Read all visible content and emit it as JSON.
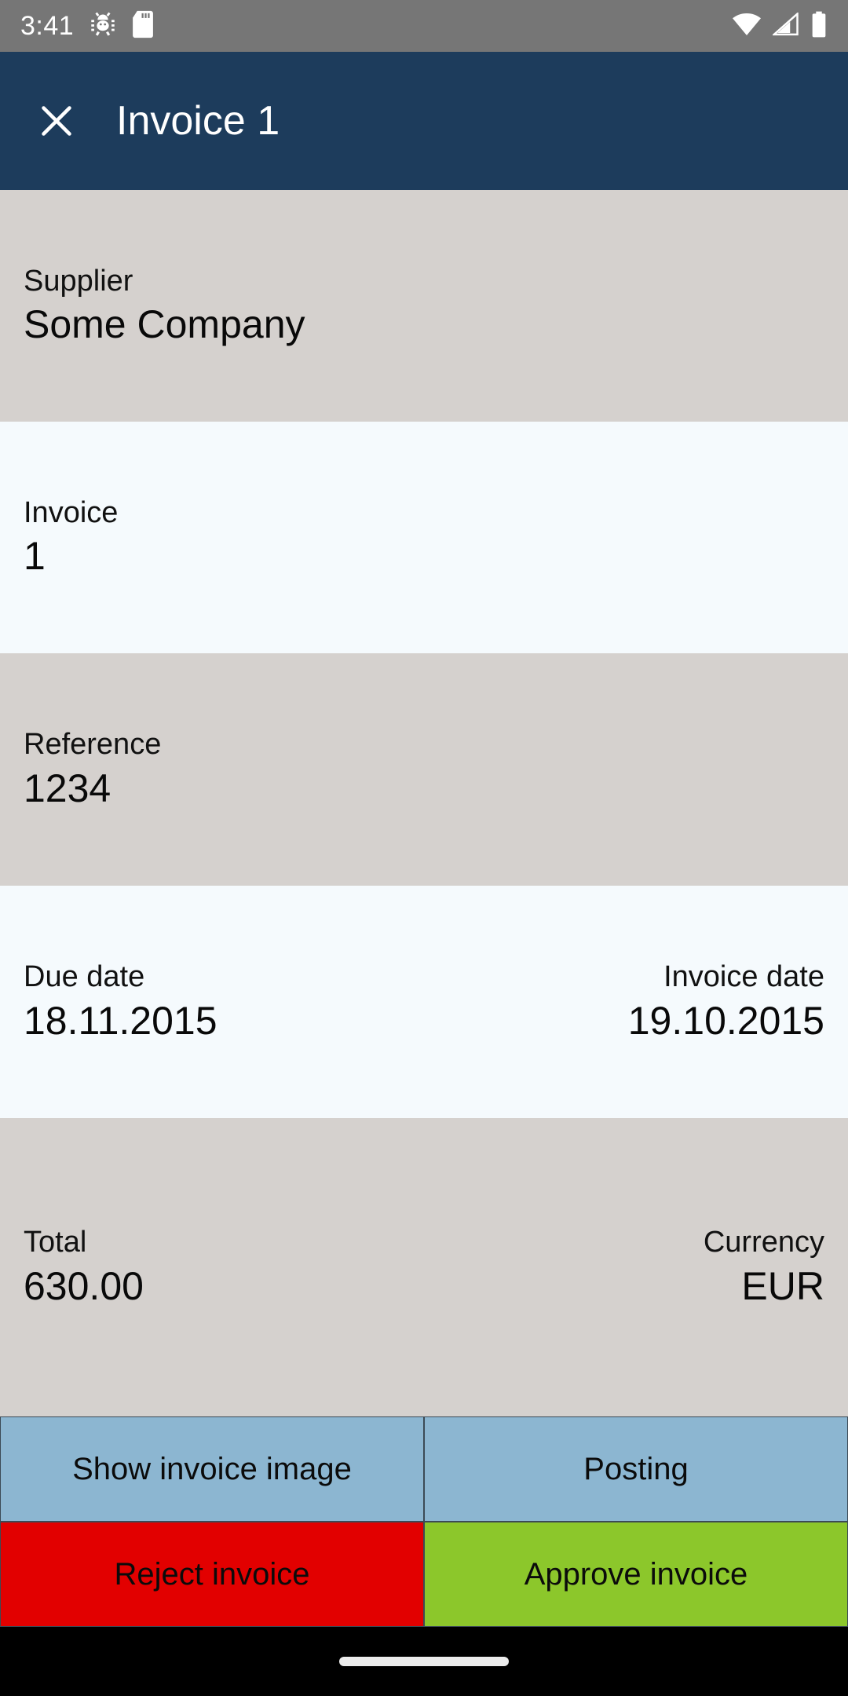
{
  "status_bar": {
    "time": "3:41",
    "left_icons": [
      "android-bug-icon",
      "sd-card-icon"
    ],
    "right_icons": [
      "wifi-icon",
      "cellular-signal-icon",
      "battery-icon"
    ],
    "background_color": "#767676"
  },
  "app_bar": {
    "close_icon": "close-icon",
    "title": "Invoice 1",
    "background_color": "#1d3c5c",
    "text_color": "#ffffff"
  },
  "fields": [
    {
      "key": "supplier",
      "style": "alt",
      "layout": "single",
      "label": "Supplier",
      "value": "Some Company"
    },
    {
      "key": "invoice",
      "style": "base",
      "layout": "single",
      "label": "Invoice",
      "value": "1"
    },
    {
      "key": "reference",
      "style": "alt",
      "layout": "single",
      "label": "Reference",
      "value": "1234"
    },
    {
      "key": "dates",
      "style": "base",
      "layout": "pair",
      "left_label": "Due date",
      "left_value": "18.11.2015",
      "right_label": "Invoice date",
      "right_value": "19.10.2015"
    },
    {
      "key": "totals",
      "style": "alt",
      "layout": "pair",
      "left_label": "Total",
      "left_value": "630.00",
      "right_label": "Currency",
      "right_value": "EUR"
    }
  ],
  "actions": {
    "show_invoice_image": "Show invoice image",
    "posting": "Posting",
    "reject_invoice": "Reject invoice",
    "approve_invoice": "Approve invoice",
    "colors": {
      "secondary": "#8cb6d1",
      "reject": "#e20000",
      "approve": "#8cc72b"
    }
  },
  "nav_bar": {
    "gesture_pill": "home-gesture-pill",
    "background_color": "#000000"
  },
  "row_colors": {
    "alt": "#d5d1ce",
    "base": "#f5fafd"
  }
}
